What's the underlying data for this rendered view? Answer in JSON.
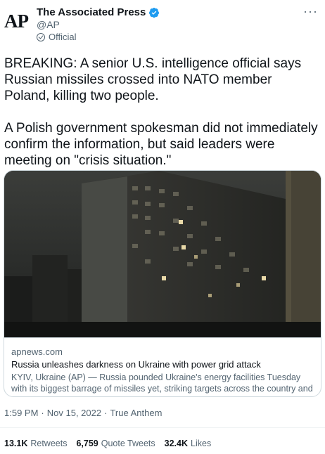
{
  "author": {
    "logo_text": "AP",
    "name": "The Associated Press",
    "handle": "@AP",
    "official_label": "Official",
    "more_label": "···"
  },
  "tweet": {
    "paragraph_1": "BREAKING: A senior U.S. intelligence official says Russian missiles crossed into NATO member Poland, killing two people.",
    "paragraph_2": "A Polish government spokesman did not immediately confirm the information, but said leaders were meeting on \"crisis situation.\""
  },
  "card": {
    "domain": "apnews.com",
    "title": "Russia unleashes darkness on Ukraine with power grid attack",
    "description": "KYIV, Ukraine (AP) — Russia pounded Ukraine's energy facilities Tuesday with its biggest barrage of missiles yet, striking targets across the country and ..."
  },
  "meta": {
    "time": "1:59 PM",
    "separator_1": "·",
    "date": "Nov 15, 2022",
    "separator_2": "·",
    "source": "True Anthem"
  },
  "stats": {
    "retweets_count": "13.1K",
    "retweets_label": "Retweets",
    "quotes_count": "6,759",
    "quotes_label": "Quote Tweets",
    "likes_count": "32.4K",
    "likes_label": "Likes"
  },
  "colors": {
    "text": "#0f1419",
    "secondary": "#536471",
    "verified": "#1d9bf0",
    "border": "#cfd9de"
  }
}
